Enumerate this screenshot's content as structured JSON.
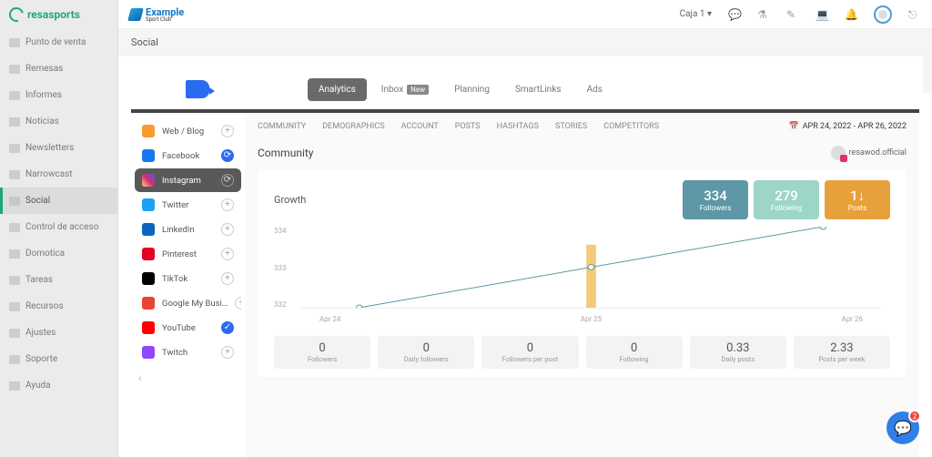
{
  "brand": "resasports",
  "club": {
    "name": "Example",
    "sub": "Sport Club"
  },
  "topbar": {
    "dropdown": "Caja 1 ▾"
  },
  "breadcrumb": "Social",
  "sidebar": {
    "items": [
      {
        "label": "Punto de venta"
      },
      {
        "label": "Remesas"
      },
      {
        "label": "Informes"
      },
      {
        "label": "Noticias"
      },
      {
        "label": "Newsletters"
      },
      {
        "label": "Narrowcast"
      },
      {
        "label": "Social"
      },
      {
        "label": "Control de acceso"
      },
      {
        "label": "Domotica"
      },
      {
        "label": "Tareas"
      },
      {
        "label": "Recursos"
      },
      {
        "label": "Ajustes"
      },
      {
        "label": "Soporte"
      },
      {
        "label": "Ayuda"
      }
    ],
    "active_index": 6
  },
  "metricool": {
    "tabs": [
      {
        "label": "Analytics"
      },
      {
        "label": "Inbox",
        "badge": "New"
      },
      {
        "label": "Planning"
      },
      {
        "label": "SmartLinks"
      },
      {
        "label": "Ads"
      }
    ],
    "active_tab": 0,
    "socials": [
      {
        "label": "Web / Blog"
      },
      {
        "label": "Facebook"
      },
      {
        "label": "Instagram"
      },
      {
        "label": "Twitter"
      },
      {
        "label": "LinkedIn"
      },
      {
        "label": "Pinterest"
      },
      {
        "label": "TikTok"
      },
      {
        "label": "Google My Busi…"
      },
      {
        "label": "YouTube"
      },
      {
        "label": "Twitch"
      }
    ],
    "active_social": 2,
    "subtabs": [
      "COMMUNITY",
      "DEMOGRAPHICS",
      "ACCOUNT",
      "POSTS",
      "HASHTAGS",
      "STORIES",
      "COMPETITORS"
    ],
    "date_range": "APR 24, 2022 - APR 26, 2022",
    "section_title": "Community",
    "account": "resawod.official",
    "card": {
      "title": "Growth",
      "stats": [
        {
          "value": "334",
          "label": "Followers"
        },
        {
          "value": "279",
          "label": "Following"
        },
        {
          "value": "1↓",
          "label": "Posts"
        }
      ],
      "mini": [
        {
          "value": "0",
          "label": "Followers"
        },
        {
          "value": "0",
          "label": "Daily followers"
        },
        {
          "value": "0",
          "label": "Followers per post"
        },
        {
          "value": "0",
          "label": "Following"
        },
        {
          "value": "0.33",
          "label": "Daily posts"
        },
        {
          "value": "2.33",
          "label": "Posts per week"
        }
      ]
    }
  },
  "chat_badge": "2",
  "chart_data": {
    "type": "line",
    "title": "Growth",
    "xlabel": "",
    "ylabel": "",
    "ylim": [
      332,
      334
    ],
    "y_ticks": [
      332,
      333,
      334
    ],
    "categories": [
      "Apr 24",
      "Apr 25",
      "Apr 26"
    ],
    "series": [
      {
        "name": "Followers line",
        "values": [
          332,
          333,
          334
        ]
      }
    ],
    "bars": [
      {
        "x": "Apr 25",
        "value": 1,
        "series": "Posts"
      }
    ]
  }
}
